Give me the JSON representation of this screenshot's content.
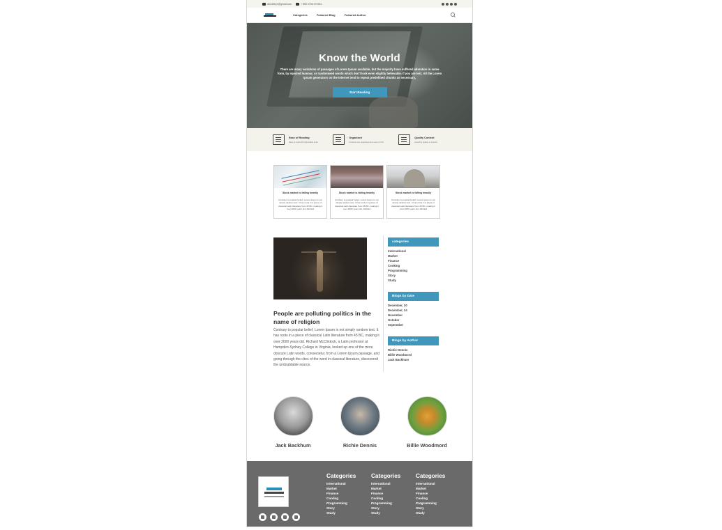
{
  "topbar": {
    "email": "abcdefnpr@gmail.com",
    "phone": "+ 880 0756 979351",
    "social_label": "f ⓘ in t Fill"
  },
  "nav": {
    "links": [
      "Categories",
      "Featured Blog",
      "Featured Author"
    ]
  },
  "hero": {
    "title": "Know the World",
    "text": "There are many variations of passages of Lorem Ipsum available, but the majority have suffered alteration in some form, by injected humour, or randomised words which don't look even slightly believable. If you are test. All the Lorem Ipsum generators on the Internet tend to repeat predefined chunks as necessary,",
    "button": "Start Reading"
  },
  "features": [
    {
      "icon": "book-icon",
      "title": "Ease of Reading",
      "sub": "Easy to read with adjustable fonts"
    },
    {
      "icon": "list-icon",
      "title": "Organized",
      "sub": "Contents are organised and easy to find"
    },
    {
      "icon": "newspaper-icon",
      "title": "Quality Content",
      "sub": "Amazing quality of content"
    }
  ],
  "cards": [
    {
      "title": "Stock market is falling heavily",
      "body": "Contrary to popular belief, Lorem Ipsum is not simply random text. It has roots in a piece of classical Latin literature from 45 BC, making it over 2000 years old. Richard"
    },
    {
      "title": "Stock market is falling heavily",
      "body": "Contrary to popular belief, Lorem Ipsum is not simply random text. It has roots in a piece of classical Latin literature from 45 BC, making it over 2000 years old. Richard"
    },
    {
      "title": "Stock market is falling heavily",
      "body": "Contrary to popular belief, Lorem Ipsum is not simply random text. It has roots in a piece of classical Latin literature from 45 BC, making it over 2000 years old. Richard"
    }
  ],
  "article": {
    "title": "People are polluting politics in the name of religion",
    "body": "Contrary to popular belief, Lorem Ipsum is not simply random text. It has roots in a piece of classical Latin literature from 45 BC, making it over 2000 years old. Richard McClintock, a Latin professor at Hampden-Sydney College in Virginia, looked up one of the more obscure Latin words, consectetur, from a Lorem Ipsum passage, and going through the cites of the word in classical literature, discovered the undoubtable source."
  },
  "sidebar": {
    "categories_title": "categories",
    "categories": [
      "International",
      "Market",
      "Finance",
      "Cooking",
      "Programming",
      "Story",
      "Study"
    ],
    "date_title": "Blogs by Date",
    "dates": [
      "December, 30",
      "December, 24",
      "November",
      "October",
      "September"
    ],
    "author_title": "Blogs by Author",
    "authors": [
      "Richie Dennis",
      "Billie Woodmord",
      "Jack Backhum"
    ]
  },
  "authors": [
    {
      "name": "Jack Backhum"
    },
    {
      "name": "Richie Dennis"
    },
    {
      "name": "Billie Woodmord"
    }
  ],
  "footer": {
    "columns": [
      {
        "title": "Categories",
        "links": [
          "International",
          "Market",
          "Finance",
          "Cooling",
          "Programming",
          "Story",
          "Study"
        ]
      },
      {
        "title": "Categories",
        "links": [
          "International",
          "Market",
          "Finance",
          "Cooling",
          "Programming",
          "Story",
          "Study"
        ]
      },
      {
        "title": "Categories",
        "links": [
          "International",
          "Market",
          "Finance",
          "Cooling",
          "Programming",
          "Story",
          "Study"
        ]
      }
    ],
    "social_icons": [
      "facebook-icon",
      "instagram-icon",
      "twitter-icon",
      "linkedin-icon"
    ]
  },
  "colors": {
    "accent": "#3f97bb",
    "footer_bg": "#6a6a6a",
    "feature_bg": "#f3f3ec"
  }
}
